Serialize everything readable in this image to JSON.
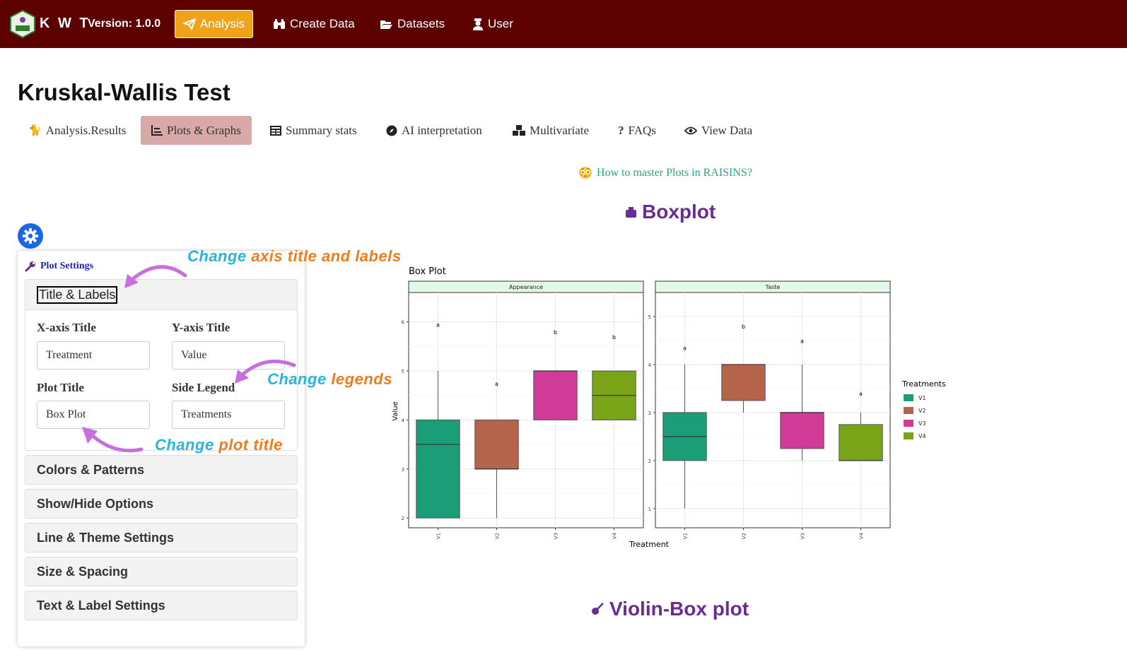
{
  "navbar": {
    "brand": "K W T",
    "version": "Version: 1.0.0",
    "items": [
      {
        "label": "Analysis",
        "icon": "paper-plane-icon",
        "active": true
      },
      {
        "label": "Create Data",
        "icon": "binoculars-icon"
      },
      {
        "label": "Datasets",
        "icon": "folder-open-icon"
      },
      {
        "label": "User",
        "icon": "user-icon"
      }
    ],
    "colors": {
      "bar": "#5c0000",
      "active": "#f0a21a"
    }
  },
  "page_title": "Kruskal-Wallis Test",
  "tabs": [
    {
      "label": "Analysis.Results",
      "icon": "cat-icon"
    },
    {
      "label": "Plots & Graphs",
      "icon": "chart-icon",
      "active": true
    },
    {
      "label": "Summary stats",
      "icon": "table-icon"
    },
    {
      "label": "AI interpretation",
      "icon": "compass-icon"
    },
    {
      "label": "Multivariate",
      "icon": "cubes-icon"
    },
    {
      "label": "FAQs",
      "icon": "question-icon"
    },
    {
      "label": "View Data",
      "icon": "eye-icon"
    }
  ],
  "help_link": "How to master Plots in RAISINS?",
  "sections": {
    "boxplot": "Boxplot",
    "violin": "Violin-Box plot"
  },
  "settings": {
    "header": "Plot Settings",
    "open_section": "Title & Labels",
    "fields": {
      "x_axis_title": {
        "label": "X-axis Title",
        "value": "Treatment"
      },
      "y_axis_title": {
        "label": "Y-axis Title",
        "value": "Value"
      },
      "plot_title": {
        "label": "Plot Title",
        "value": "Box Plot"
      },
      "side_legend": {
        "label": "Side Legend",
        "value": "Treatments"
      }
    },
    "sections": [
      "Colors & Patterns",
      "Show/Hide Options",
      "Line & Theme Settings",
      "Size & Spacing",
      "Text & Label Settings"
    ]
  },
  "annotations": {
    "axis": {
      "a": "Change",
      "b": "axis title and labels"
    },
    "legends": {
      "a": "Change",
      "b": "legends"
    },
    "plot_title": {
      "a": "Change",
      "b": "plot title"
    }
  },
  "chart_data": {
    "type": "boxplot",
    "title": "Box Plot",
    "xlabel": "Treatment",
    "ylabel": "Value",
    "legend_title": "Treatments",
    "legend_position": "right",
    "categories": [
      "V1",
      "V2",
      "V3",
      "V4"
    ],
    "colors": [
      "#1b9e77",
      "#b5634a",
      "#d13a97",
      "#7aa418"
    ],
    "panels": [
      {
        "name": "Appearance",
        "ylim": [
          1.8,
          6.6
        ],
        "yticks": [
          2,
          3,
          4,
          5,
          6
        ],
        "boxes": [
          {
            "min": 2,
            "q1": 2,
            "median": 3.5,
            "q3": 4,
            "max": 5,
            "letter": "a",
            "letter_y": 5.9
          },
          {
            "min": 2,
            "q1": 3,
            "median": 3,
            "q3": 4,
            "max": 4,
            "letter": "a",
            "letter_y": 4.7
          },
          {
            "min": 4,
            "q1": 4,
            "median": 5,
            "q3": 5,
            "max": 5,
            "letter": "b",
            "letter_y": 5.75
          },
          {
            "min": 4,
            "q1": 4,
            "median": 4.5,
            "q3": 5,
            "max": 5,
            "letter": "b",
            "letter_y": 5.65
          }
        ]
      },
      {
        "name": "Taste",
        "ylim": [
          0.6,
          5.5
        ],
        "yticks": [
          1,
          2,
          3,
          4,
          5
        ],
        "boxes": [
          {
            "min": 1,
            "q1": 2,
            "median": 2.5,
            "q3": 3,
            "max": 4,
            "letter": "a",
            "letter_y": 4.3
          },
          {
            "min": 3,
            "q1": 3.25,
            "median": 4,
            "q3": 4,
            "max": 4,
            "letter": "b",
            "letter_y": 4.75
          },
          {
            "min": 2,
            "q1": 2.25,
            "median": 3,
            "q3": 3,
            "max": 4,
            "letter": "a",
            "letter_y": 4.45
          },
          {
            "min": 2,
            "q1": 2,
            "median": 2,
            "q3": 2.75,
            "max": 3,
            "letter": "a",
            "letter_y": 3.35
          }
        ]
      }
    ]
  }
}
